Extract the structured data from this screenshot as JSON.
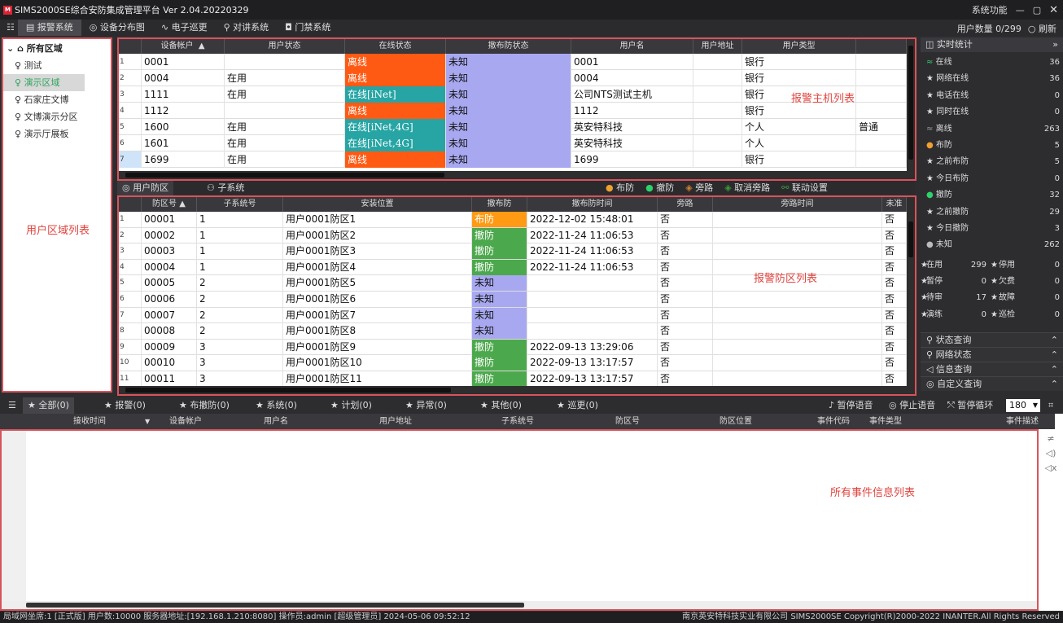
{
  "window": {
    "title": "SIMS2000SE综合安防集成管理平台  Ver 2.04.20220329",
    "logo": "M",
    "sys_func": "系统功能",
    "min": "—",
    "max": "▢",
    "close": "✕"
  },
  "menu": {
    "grid_icon": "☷",
    "items": [
      {
        "icon": "▤",
        "label": "报警系统"
      },
      {
        "icon": "◎",
        "label": "设备分布图"
      },
      {
        "icon": "∿",
        "label": "电子巡更"
      },
      {
        "icon": "⚲",
        "label": "对讲系统"
      },
      {
        "icon": "◘",
        "label": "门禁系统"
      }
    ],
    "user_count": "用户数量 0/299",
    "refresh": "○ 刷新"
  },
  "tree": {
    "root": "所有区域",
    "items": [
      "测试",
      "演示区域",
      "石家庄文博",
      "文博演示分区",
      "演示厅展板"
    ],
    "panel_label": "用户区域列表"
  },
  "host_table": {
    "columns": [
      "设备帐户",
      "用户状态",
      "在线状态",
      "撤布防状态",
      "用户名",
      "用户地址",
      "用户类型"
    ],
    "sort_marker": "▲",
    "rows": [
      {
        "n": "1",
        "acct": "0001",
        "ustat": "",
        "online": "离线",
        "arm": "未知",
        "name": "0001",
        "addr": "",
        "type": "银行",
        "x": ""
      },
      {
        "n": "2",
        "acct": "0004",
        "ustat": "在用",
        "online": "离线",
        "arm": "未知",
        "name": "0004",
        "addr": "",
        "type": "银行",
        "x": ""
      },
      {
        "n": "3",
        "acct": "1111",
        "ustat": "在用",
        "online": "在线[iNet]",
        "arm": "未知",
        "name": "公司NTS测试主机",
        "addr": "",
        "type": "银行",
        "x": ""
      },
      {
        "n": "4",
        "acct": "1112",
        "ustat": "",
        "online": "离线",
        "arm": "未知",
        "name": "1112",
        "addr": "",
        "type": "银行",
        "x": ""
      },
      {
        "n": "5",
        "acct": "1600",
        "ustat": "在用",
        "online": "在线[iNet,4G]",
        "arm": "未知",
        "name": "英安特科技",
        "addr": "",
        "type": "个人",
        "x": "普通"
      },
      {
        "n": "6",
        "acct": "1601",
        "ustat": "在用",
        "online": "在线[iNet,4G]",
        "arm": "未知",
        "name": "英安特科技",
        "addr": "",
        "type": "个人",
        "x": ""
      },
      {
        "n": "7",
        "acct": "1699",
        "ustat": "在用",
        "online": "离线",
        "arm": "未知",
        "name": "1699",
        "addr": "",
        "type": "银行",
        "x": ""
      }
    ],
    "panel_label": "报警主机列表"
  },
  "mid_tabs": {
    "tab1": "用户防区",
    "tab2": "子系统",
    "arm": "布防",
    "disarm": "撤防",
    "bypass": "旁路",
    "cancel_bypass": "取消旁路",
    "link": "联动设置"
  },
  "zone_table": {
    "columns": [
      "防区号",
      "子系统号",
      "安装位置",
      "撤布防",
      "撤布防时间",
      "旁路",
      "旁路时间",
      "未准"
    ],
    "sort_marker": "▲",
    "rows": [
      {
        "n": "1",
        "zone": "00001",
        "sub": "1",
        "loc": "用户0001防区1",
        "arm": "布防",
        "time": "2022-12-02 15:48:01",
        "bp": "否",
        "bpt": "",
        "nr": "否"
      },
      {
        "n": "2",
        "zone": "00002",
        "sub": "1",
        "loc": "用户0001防区2",
        "arm": "撤防",
        "time": "2022-11-24 11:06:53",
        "bp": "否",
        "bpt": "",
        "nr": "否"
      },
      {
        "n": "3",
        "zone": "00003",
        "sub": "1",
        "loc": "用户0001防区3",
        "arm": "撤防",
        "time": "2022-11-24 11:06:53",
        "bp": "否",
        "bpt": "",
        "nr": "否"
      },
      {
        "n": "4",
        "zone": "00004",
        "sub": "1",
        "loc": "用户0001防区4",
        "arm": "撤防",
        "time": "2022-11-24 11:06:53",
        "bp": "否",
        "bpt": "",
        "nr": "否"
      },
      {
        "n": "5",
        "zone": "00005",
        "sub": "2",
        "loc": "用户0001防区5",
        "arm": "未知",
        "time": "",
        "bp": "否",
        "bpt": "",
        "nr": "否"
      },
      {
        "n": "6",
        "zone": "00006",
        "sub": "2",
        "loc": "用户0001防区6",
        "arm": "未知",
        "time": "",
        "bp": "否",
        "bpt": "",
        "nr": "否"
      },
      {
        "n": "7",
        "zone": "00007",
        "sub": "2",
        "loc": "用户0001防区7",
        "arm": "未知",
        "time": "",
        "bp": "否",
        "bpt": "",
        "nr": "否"
      },
      {
        "n": "8",
        "zone": "00008",
        "sub": "2",
        "loc": "用户0001防区8",
        "arm": "未知",
        "time": "",
        "bp": "否",
        "bpt": "",
        "nr": "否"
      },
      {
        "n": "9",
        "zone": "00009",
        "sub": "3",
        "loc": "用户0001防区9",
        "arm": "撤防",
        "time": "2022-09-13 13:29:06",
        "bp": "否",
        "bpt": "",
        "nr": "否"
      },
      {
        "n": "10",
        "zone": "00010",
        "sub": "3",
        "loc": "用户0001防区10",
        "arm": "撤防",
        "time": "2022-09-13 13:17:57",
        "bp": "否",
        "bpt": "",
        "nr": "否"
      },
      {
        "n": "11",
        "zone": "00011",
        "sub": "3",
        "loc": "用户0001防区11",
        "arm": "撤防",
        "time": "2022-09-13 13:17:57",
        "bp": "否",
        "bpt": "",
        "nr": "否"
      }
    ],
    "panel_label": "报警防区列表"
  },
  "stats": {
    "title": "实时统计",
    "collapse": "»",
    "lines": [
      {
        "label": "在线",
        "value": "36",
        "icon": "≈",
        "color": "#2fd16a"
      },
      {
        "label": "网络在线",
        "value": "36",
        "icon": "★",
        "color": "#ddd"
      },
      {
        "label": "电话在线",
        "value": "0",
        "icon": "★",
        "color": "#ddd"
      },
      {
        "label": "同时在线",
        "value": "0",
        "icon": "★",
        "color": "#ddd"
      },
      {
        "label": "离线",
        "value": "263",
        "icon": "≈",
        "color": "#999"
      },
      {
        "label": "布防",
        "value": "5",
        "icon": "●",
        "color": "#f0a030"
      },
      {
        "label": "之前布防",
        "value": "5",
        "icon": "★",
        "color": "#ddd"
      },
      {
        "label": "今日布防",
        "value": "0",
        "icon": "★",
        "color": "#ddd"
      },
      {
        "label": "撤防",
        "value": "32",
        "icon": "●",
        "color": "#2fd16a"
      },
      {
        "label": "之前撤防",
        "value": "29",
        "icon": "★",
        "color": "#ddd"
      },
      {
        "label": "今日撤防",
        "value": "3",
        "icon": "★",
        "color": "#ddd"
      },
      {
        "label": "未知",
        "value": "262",
        "icon": "●",
        "color": "#bbb"
      }
    ],
    "pairs": [
      {
        "a": "在用",
        "av": "299",
        "b": "停用",
        "bv": "0"
      },
      {
        "a": "暂停",
        "av": "0",
        "b": "欠费",
        "bv": "0"
      },
      {
        "a": "待审",
        "av": "17",
        "b": "故障",
        "bv": "0"
      },
      {
        "a": "演练",
        "av": "0",
        "b": "巡检",
        "bv": "0"
      }
    ],
    "sections": [
      "状态查询",
      "网络状态",
      "信息查询",
      "自定义查询"
    ]
  },
  "event_tabs": {
    "tabs": [
      "全部(0)",
      "报警(0)",
      "布撤防(0)",
      "系统(0)",
      "计划(0)",
      "异常(0)",
      "其他(0)",
      "巡更(0)"
    ],
    "pause_voice": "暂停语音",
    "stop_voice": "停止语音",
    "pause_loop": "暂停循环",
    "count": "180"
  },
  "event_table": {
    "columns": [
      "接收时间",
      "设备帐户",
      "用户名",
      "用户地址",
      "子系统号",
      "防区号",
      "防区位置",
      "事件代码",
      "事件类型",
      "事件描述"
    ],
    "panel_label": "所有事件信息列表"
  },
  "status": {
    "left": "局域网坐席:1 [正式版] 用户数:10000 服务器地址:[192.168.1.210:8080]  操作员:admin [超级管理员]    2024-05-06 09:52:12",
    "right": "南京英安特科技实业有限公司   SIMS2000SE Copyright(R)2000-2022 INANTER.All Rights Reserved"
  },
  "colors": {
    "offline": "#ff5a14",
    "online": "#27a4a4",
    "unknown": "#a8a8f0",
    "armed": "#ff9a14",
    "disarmed": "#4ca84c",
    "red_border": "#d9535b"
  }
}
